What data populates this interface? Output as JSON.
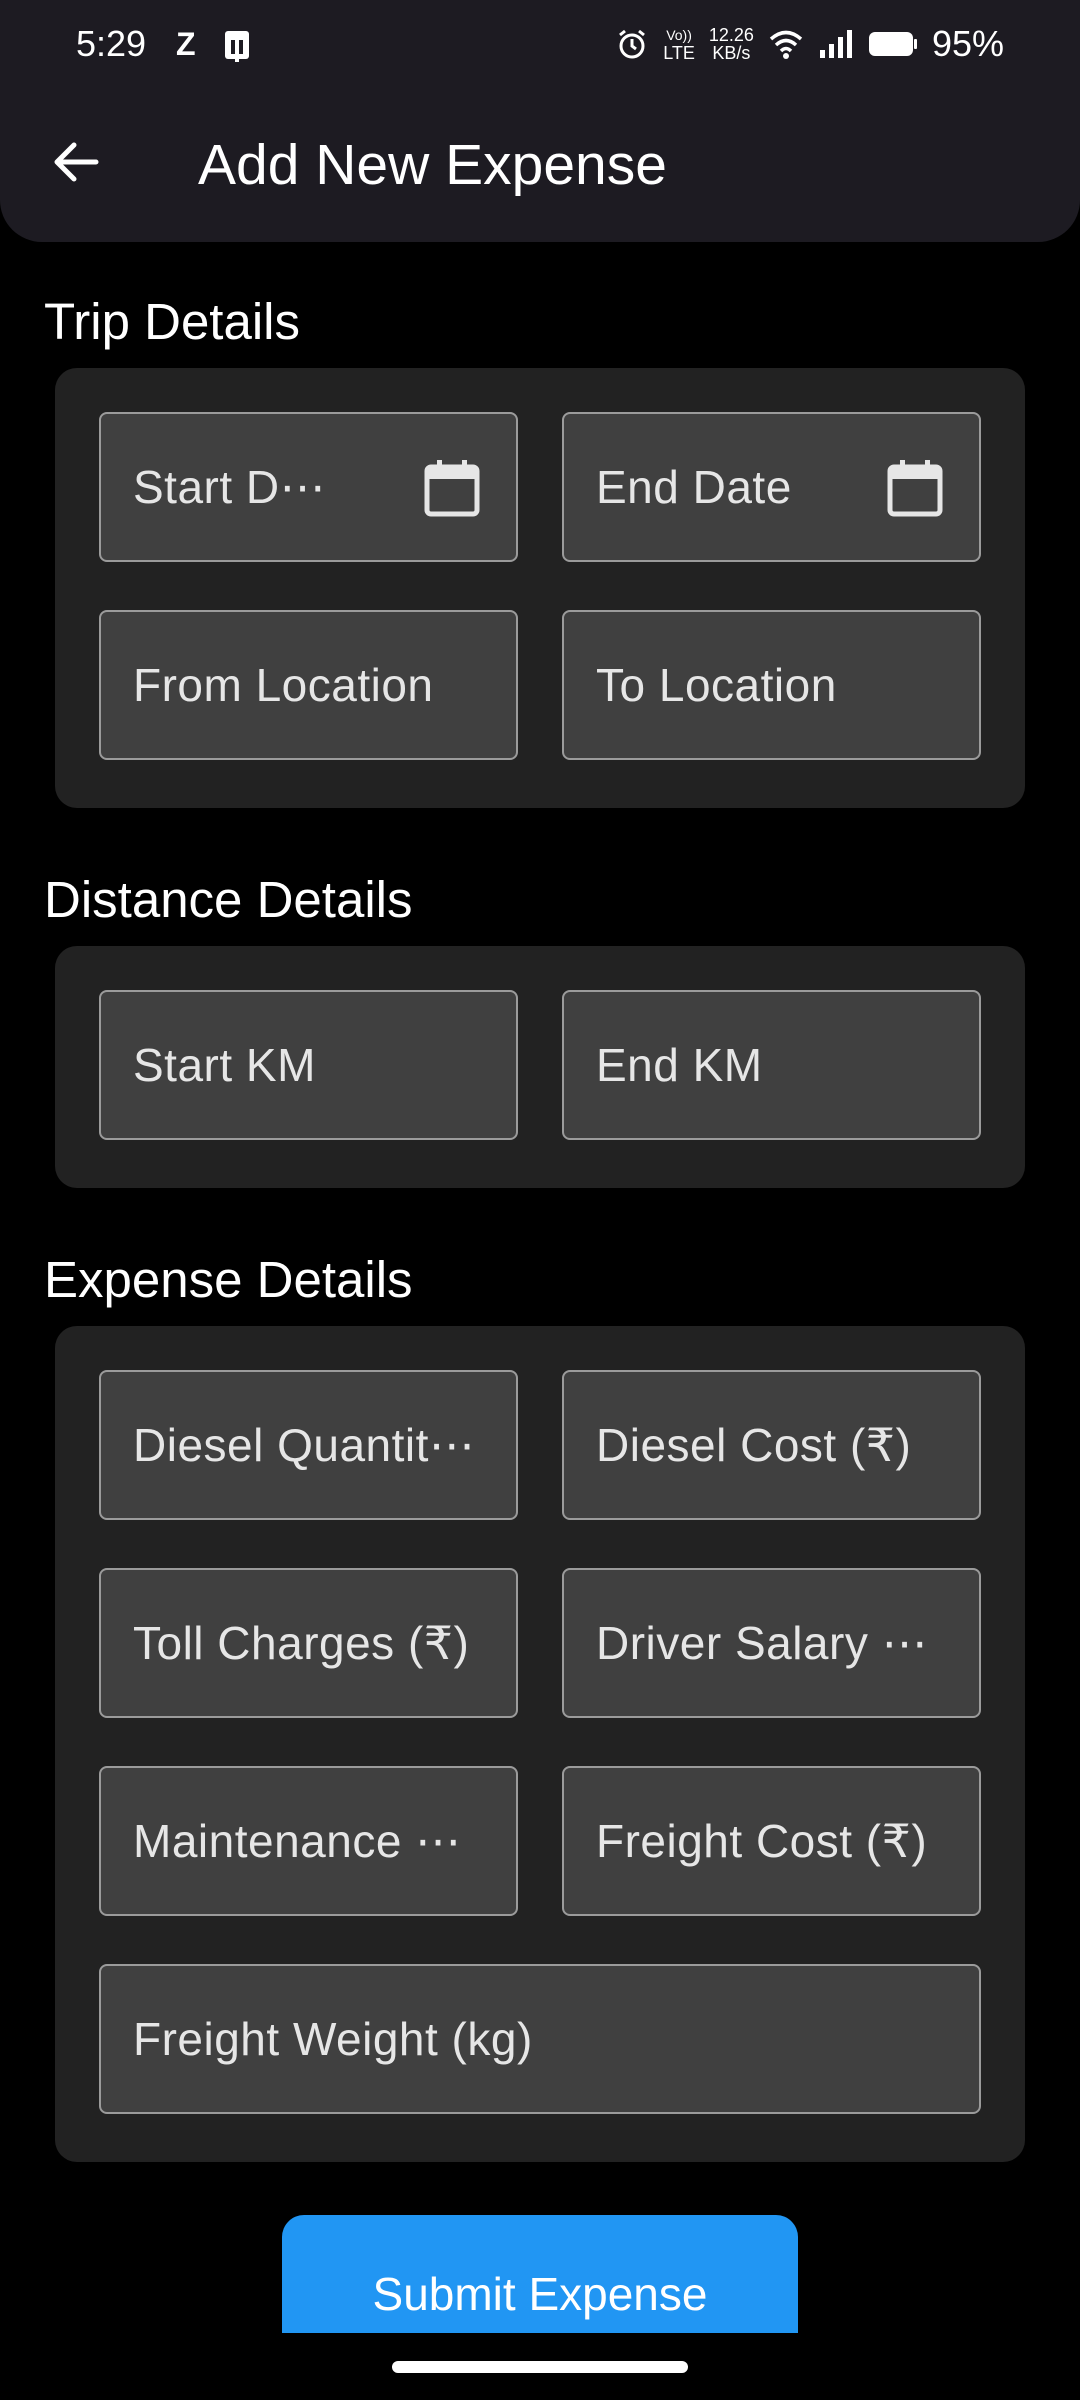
{
  "status_bar": {
    "time": "5:29",
    "app_icon_letter": "Z",
    "network_type_top": "Vo))",
    "network_type_bottom": "LTE",
    "speed_value": "12.26",
    "speed_unit": "KB/s",
    "battery": "95%"
  },
  "app_bar": {
    "title": "Add New Expense"
  },
  "trip": {
    "title": "Trip Details",
    "start_date": "Start D⋯",
    "end_date": "End Date",
    "from_location": "From Location",
    "to_location": "To Location"
  },
  "distance": {
    "title": "Distance Details",
    "start_km": "Start KM",
    "end_km": "End KM"
  },
  "expense": {
    "title": "Expense Details",
    "diesel_quantity": "Diesel Quantit⋯",
    "diesel_cost": "Diesel Cost (₹)",
    "toll_charges": "Toll Charges (₹)",
    "driver_salary": "Driver Salary ⋯",
    "maintenance": "Maintenance ⋯",
    "freight_cost": "Freight Cost (₹)",
    "freight_weight": "Freight Weight (kg)"
  },
  "submit_label": "Submit Expense",
  "colors": {
    "background": "#000000",
    "app_bar": "#1d1b22",
    "card": "#222222",
    "field": "#404040",
    "field_border": "#9b9b9b",
    "accent": "#2196f3"
  },
  "icons": [
    "back-arrow-icon",
    "calendar-icon",
    "alarm-icon",
    "wifi-icon",
    "signal-icon",
    "battery-icon"
  ]
}
